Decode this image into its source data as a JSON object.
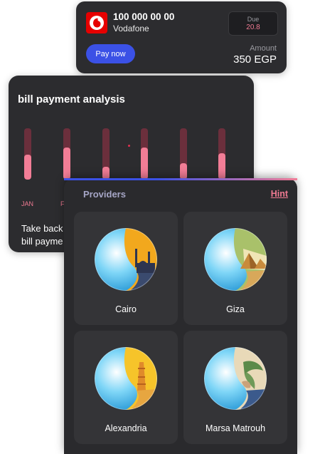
{
  "bill": {
    "number": "100 000 00 00",
    "provider": "Vodafone",
    "due_label": "Due",
    "due_value": "20.8",
    "pay_label": "Pay now",
    "amount_label": "Amount",
    "amount_value": "350 EGP",
    "brand_color": "#e60000",
    "accent_color": "#3b51e6"
  },
  "analysis": {
    "title": "bill payment analysis",
    "text_line1": "Take back",
    "text_line2": "bill payme",
    "bars": [
      {
        "label": "JAN",
        "fill": 0.48
      },
      {
        "label": "F",
        "fill": 0.62
      },
      {
        "label": "",
        "fill": 0.25
      },
      {
        "label": "",
        "fill": 0.62
      },
      {
        "label": "",
        "fill": 0.32
      },
      {
        "label": "",
        "fill": 0.52
      }
    ],
    "bar_color": "#f27d96",
    "track_color": "#6b2f3c"
  },
  "providers": {
    "title": "Providers",
    "hint": "Hint",
    "items": [
      {
        "name": "Cairo",
        "icon": "cairo-mosque-emblem-icon"
      },
      {
        "name": "Giza",
        "icon": "giza-pyramids-emblem-icon"
      },
      {
        "name": "Alexandria",
        "icon": "alexandria-lighthouse-emblem-icon"
      },
      {
        "name": "Marsa Matrouh",
        "icon": "marsa-matrouh-emblem-icon"
      }
    ]
  }
}
